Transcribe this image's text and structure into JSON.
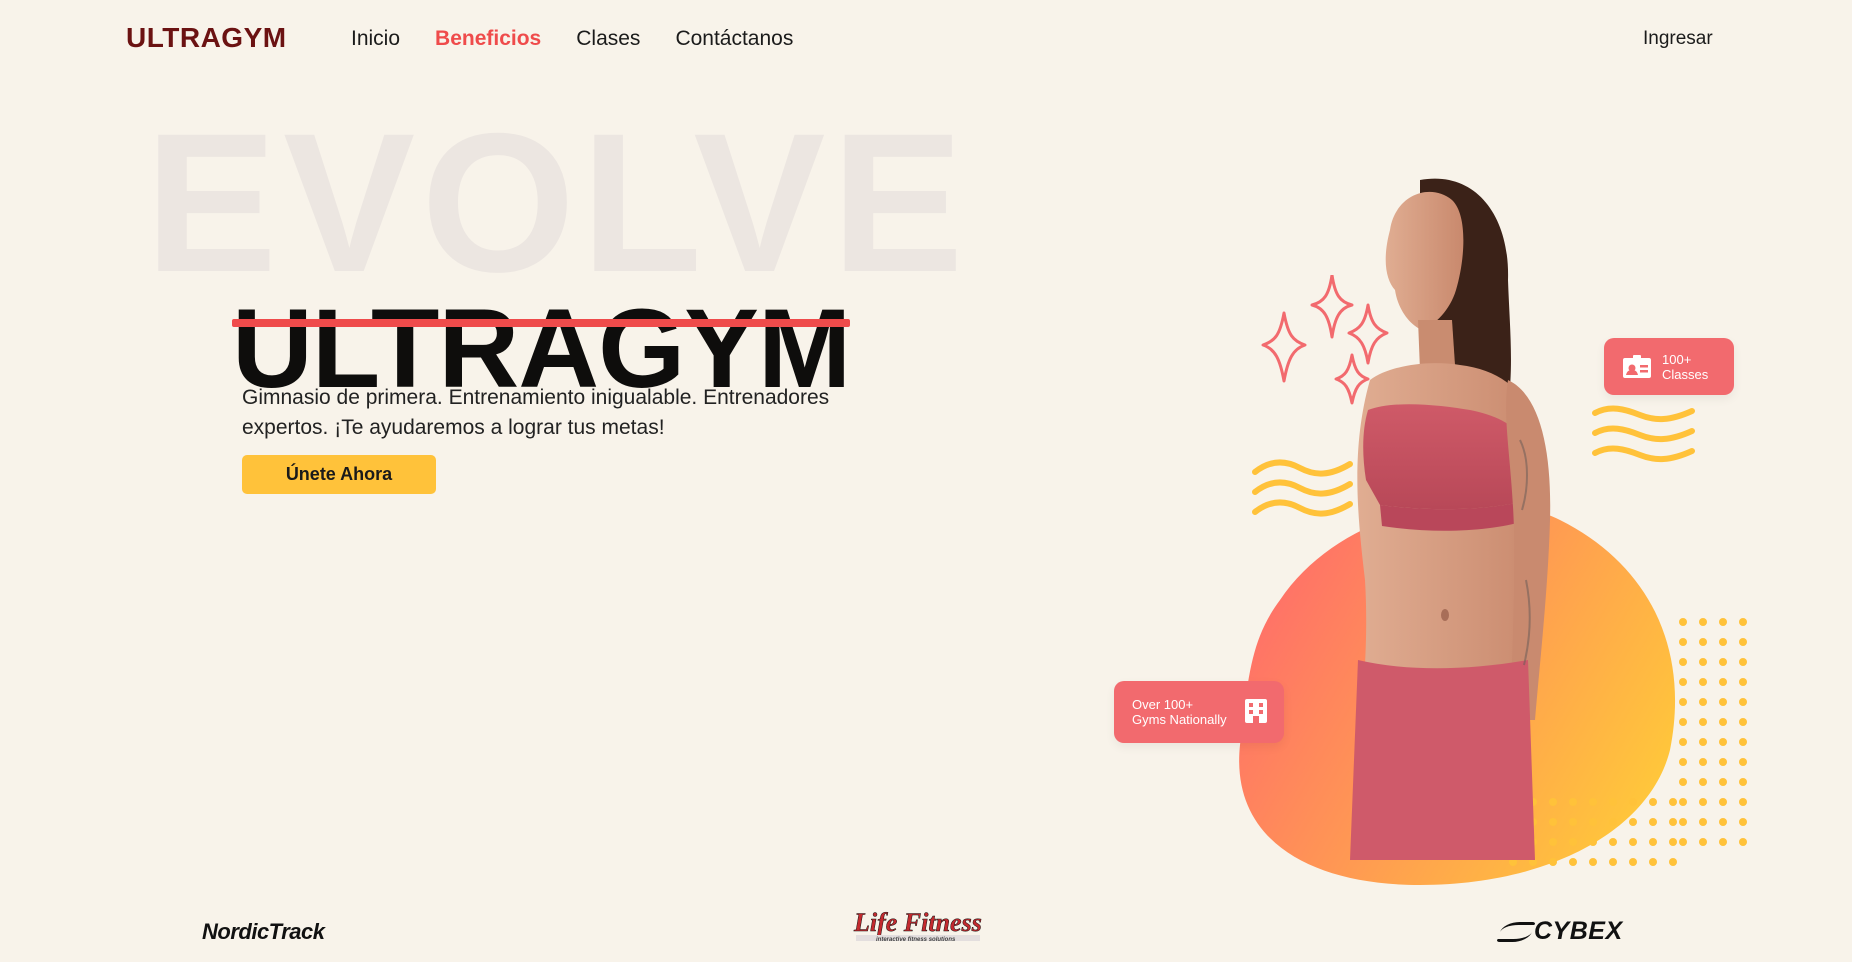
{
  "header": {
    "logo": "ULTRAGYM",
    "nav": [
      {
        "label": "Inicio",
        "active": false
      },
      {
        "label": "Beneficios",
        "active": true
      },
      {
        "label": "Clases",
        "active": false
      },
      {
        "label": "Contáctanos",
        "active": false
      }
    ],
    "login": "Ingresar"
  },
  "hero": {
    "background_word": "EVOLVE",
    "title": "ULTRAGYM",
    "description_line1": "Gimnasio de primera. Entrenamiento inigualable. Entrenadores",
    "description_line2": "expertos. ¡Te ayudaremos a lograr tus metas!",
    "cta": "Únete Ahora"
  },
  "badges": {
    "classes": {
      "line1": "100+",
      "line2": "Classes",
      "icon": "id-card-icon"
    },
    "gyms": {
      "line1": "Over 100+",
      "line2": "Gyms Nationally",
      "icon": "building-icon"
    }
  },
  "brands": [
    "NordicTrack",
    "Life Fitness",
    "CYBEX"
  ],
  "colors": {
    "background": "#f8f3ea",
    "accent": "#ef4b4b",
    "logo": "#6b1212",
    "cta": "#ffc23a",
    "badge": "#f26a6e"
  }
}
